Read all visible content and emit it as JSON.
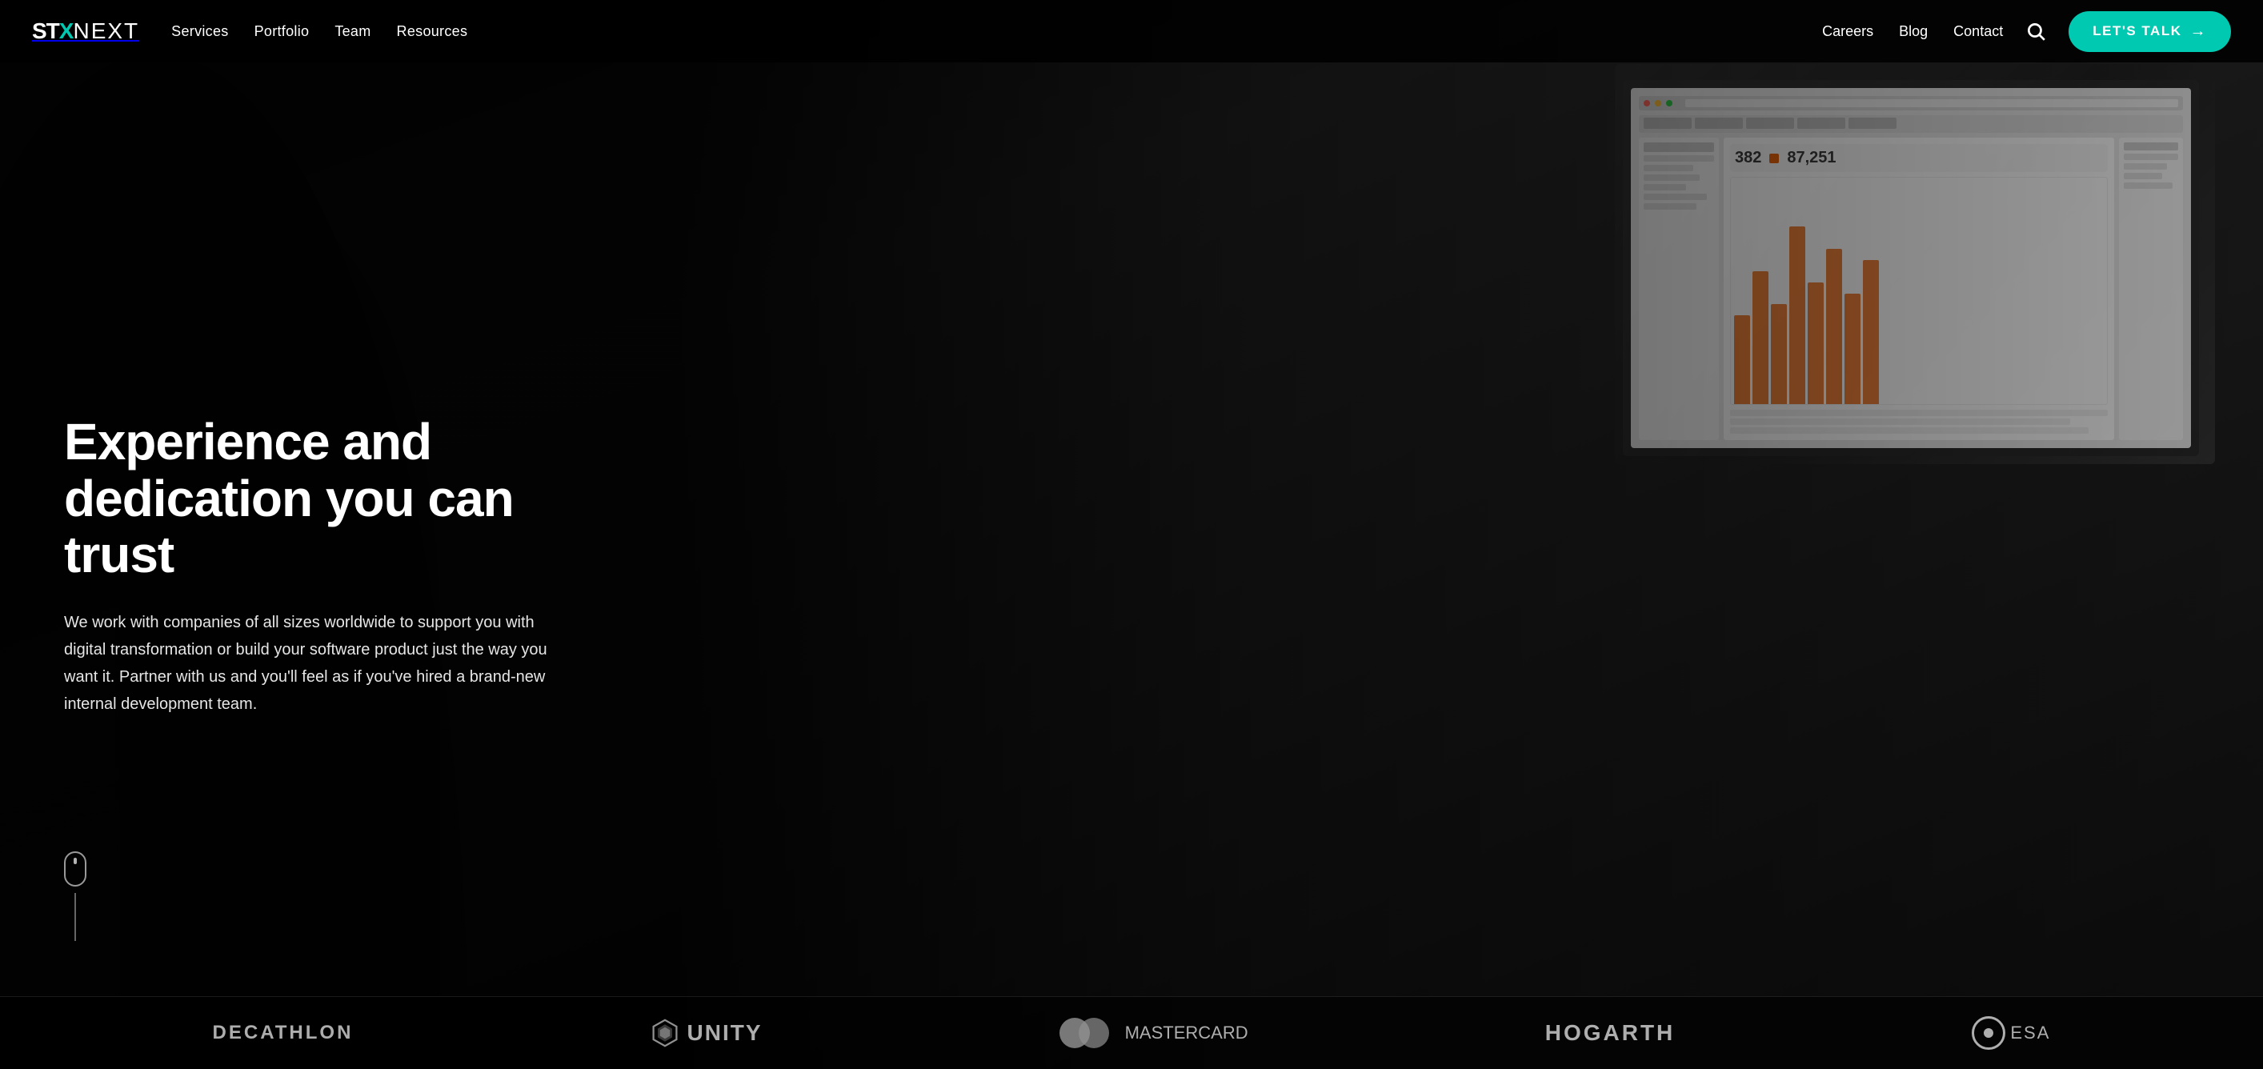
{
  "brand": {
    "stx": "STX",
    "next": "NEXT",
    "logo_x": "X"
  },
  "nav": {
    "left_links": [
      {
        "label": "Services",
        "href": "#"
      },
      {
        "label": "Portfolio",
        "href": "#"
      },
      {
        "label": "Team",
        "href": "#"
      },
      {
        "label": "Resources",
        "href": "#"
      }
    ],
    "right_links": [
      {
        "label": "Careers",
        "href": "#"
      },
      {
        "label": "Blog",
        "href": "#"
      },
      {
        "label": "Contact",
        "href": "#"
      }
    ],
    "cta_label": "LET'S TALK",
    "cta_arrow": "→"
  },
  "hero": {
    "title_line1": "Experience and",
    "title_line2": "dedication you can trust",
    "subtitle": "We work with companies of all sizes worldwide to support you with digital transformation or build your software product just the way you want it. Partner with us and you'll feel as if you've hired a brand-new internal development team.",
    "monitor_stat1": "382",
    "monitor_stat2": "87,251"
  },
  "clients": [
    {
      "name": "Decathlon",
      "type": "text"
    },
    {
      "name": "Unity",
      "type": "hex+text"
    },
    {
      "name": "mastercard",
      "type": "circles+text"
    },
    {
      "name": "HOGARTH",
      "type": "text"
    },
    {
      "name": "esa",
      "type": "circle+text"
    }
  ],
  "colors": {
    "accent": "#00c9b1",
    "dark_bg": "#0d0d0d",
    "text_primary": "#ffffff",
    "text_muted": "rgba(255,255,255,0.85)"
  }
}
